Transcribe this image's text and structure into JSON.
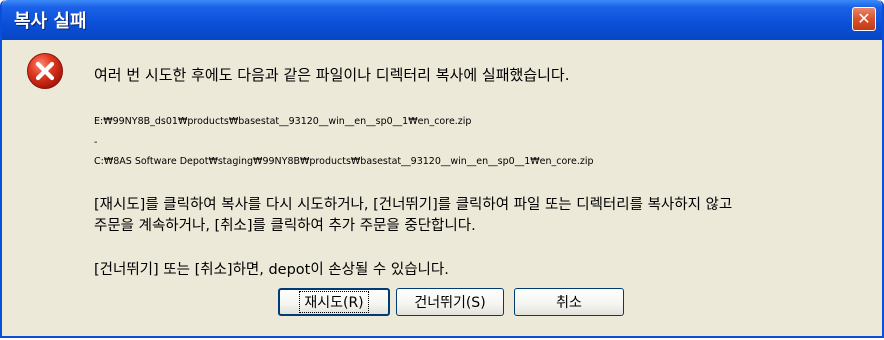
{
  "window": {
    "title": "복사 실패",
    "close_label": "✕"
  },
  "dialog": {
    "icon": "error-icon",
    "heading": "여러 번 시도한 후에도 다음과 같은 파일이나 디렉터리 복사에 실패했습니다.",
    "source_path": "E:₩99NY8B_ds01₩products₩basestat__93120__win__en__sp0__1₩en_core.zip",
    "separator": "-",
    "dest_path": "C:₩8AS Software Depot₩staging₩99NY8B₩products₩basestat__93120__win__en__sp0__1₩en_core.zip",
    "instruction_line1": "[재시도]를 클릭하여 복사를 다시 시도하거나, [건너뛰기]를 클릭하여 파일 또는 디렉터리를 복사하지 않고",
    "instruction_line2": "주문을 계속하거나, [취소]를 클릭하여 추가 주문을 중단합니다.",
    "warning": "[건너뛰기] 또는 [취소]하면, depot이 손상될 수 있습니다."
  },
  "buttons": {
    "retry": "재시도(R)",
    "skip": "건너뛰기(S)",
    "cancel": "취소"
  },
  "colors": {
    "titlebar": "#0a4fd8",
    "close_button": "#d8512e",
    "error_icon": "#d8281a",
    "dialog_bg": "#ece9d8"
  }
}
